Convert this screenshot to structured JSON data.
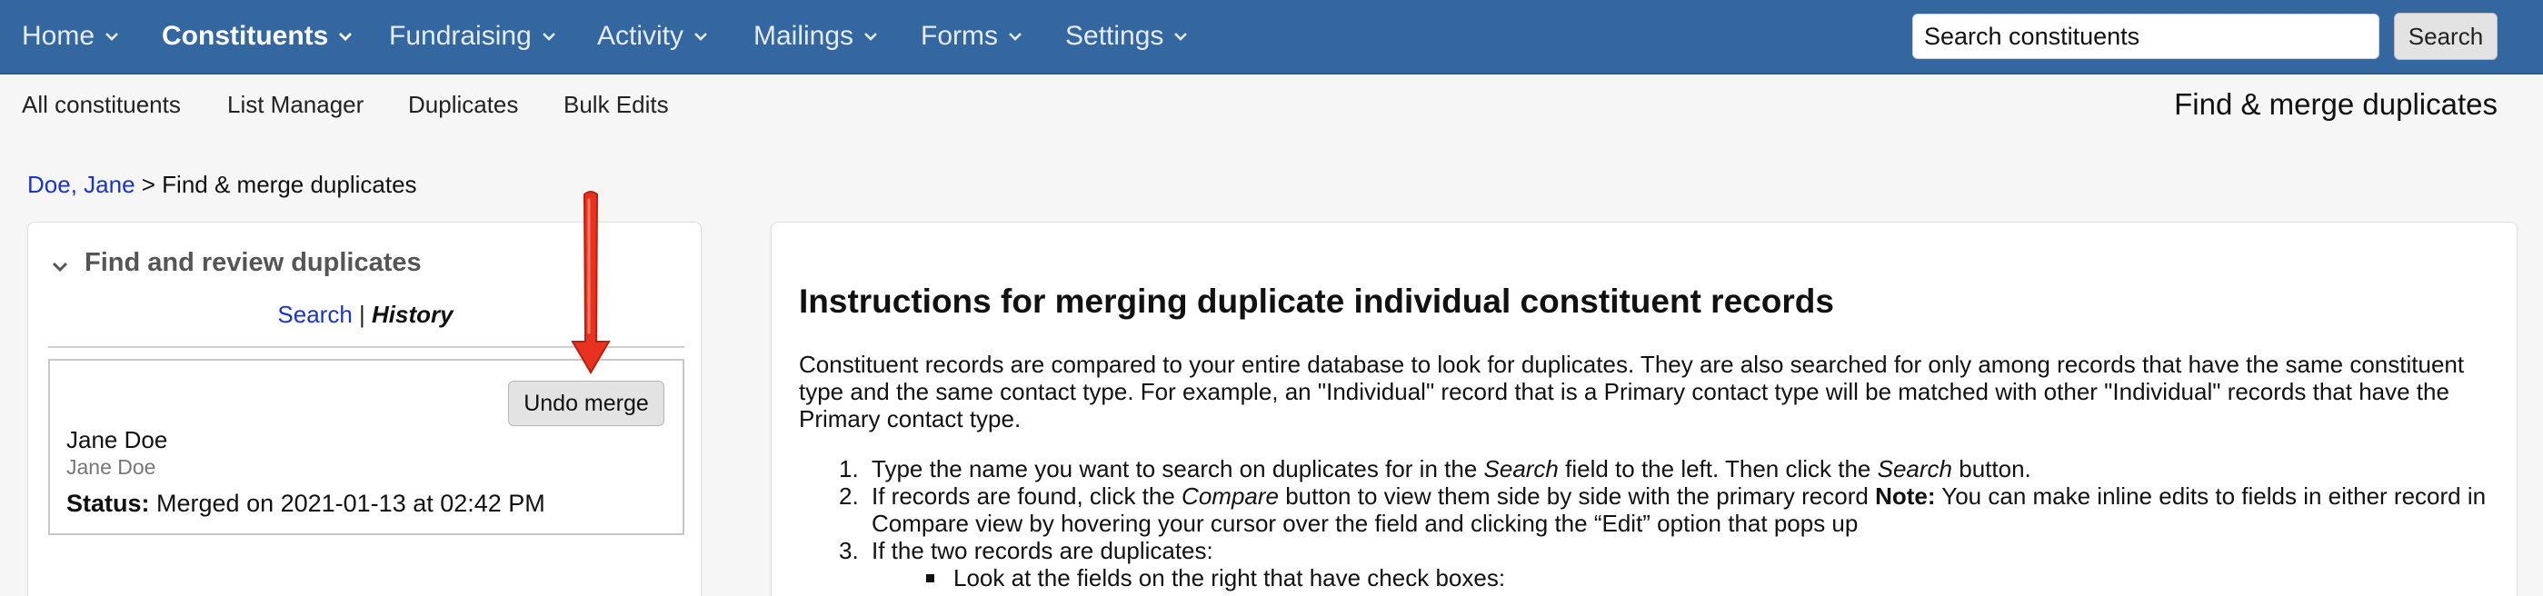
{
  "topnav": {
    "items": [
      {
        "label": "Home",
        "active": false
      },
      {
        "label": "Constituents",
        "active": true
      },
      {
        "label": "Fundraising",
        "active": false
      },
      {
        "label": "Activity",
        "active": false
      },
      {
        "label": "Mailings",
        "active": false
      },
      {
        "label": "Forms",
        "active": false
      },
      {
        "label": "Settings",
        "active": false
      }
    ],
    "search_value": "Search constituents",
    "search_button": "Search",
    "bar_color": "#3466a0"
  },
  "subnav": {
    "items": [
      "All constituents",
      "List Manager",
      "Duplicates",
      "Bulk Edits"
    ],
    "page_heading": "Find & merge duplicates"
  },
  "breadcrumb": {
    "link": "Doe, Jane",
    "separator": " > ",
    "current": "Find & merge duplicates"
  },
  "left_panel": {
    "header": "Find and review duplicates",
    "header_icon": "chevron-down-icon",
    "tab_search": "Search",
    "tab_separator": " | ",
    "tab_history": "History",
    "result": {
      "undo_button": "Undo merge",
      "name": "Jane Doe",
      "subname": "Jane Doe",
      "status_label": "Status:",
      "status_value": " Merged on 2021-01-13 at 02:42 PM"
    },
    "annotation": {
      "icon": "red-arrow-icon",
      "color": "#e8321f"
    }
  },
  "right_panel": {
    "title": "Instructions for merging duplicate individual constituent records",
    "paragraph": "Constituent records are compared to your entire database to look for duplicates. They are also searched for only among records that have the same constituent type and the same contact type. For example, an \"Individual\" record that is a Primary contact type will be matched with other \"Individual\" records that have the Primary contact type.",
    "steps": [
      {
        "num": "1.",
        "pre": "Type the name you want to search on duplicates for in the ",
        "em1": "Search",
        "mid": " field to the left. Then click the ",
        "em2": "Search",
        "post": " button."
      },
      {
        "num": "2.",
        "pre": "If records are found, click the ",
        "em1": "Compare",
        "mid": " button to view them side by side with the primary record ",
        "strong": "Note:",
        "post": " You can make inline edits to fields in either record in Compare view by hovering your cursor over the field and clicking the “Edit” option that pops up"
      },
      {
        "num": "3.",
        "text": "If the two records are duplicates:"
      }
    ],
    "sub_steps": [
      "Look at the fields on the right that have check boxes:"
    ]
  }
}
